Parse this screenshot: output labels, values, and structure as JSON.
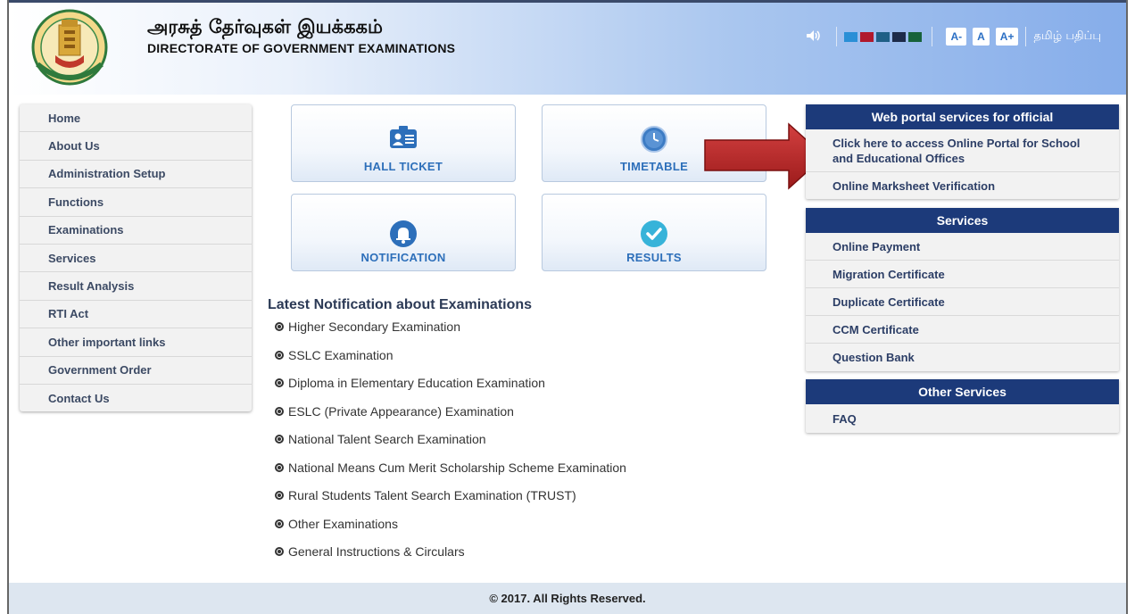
{
  "header": {
    "title_tamil": "அரசுத் தேர்வுகள் இயக்ககம்",
    "title_english": "DIRECTORATE OF GOVERNMENT EXAMINATIONS",
    "emblem_icon": "tamilnadu-emblem-icon",
    "speaker_icon": "speaker-icon",
    "color_themes": [
      "#2a8fd6",
      "#b0182c",
      "#1f5f86",
      "#1d2b4a",
      "#17623a"
    ],
    "font_buttons": [
      "A-",
      "A",
      "A+"
    ],
    "language_link": "தமிழ் பதிப்பு"
  },
  "nav": {
    "items": [
      "Home",
      "About Us",
      "Administration Setup",
      "Functions",
      "Examinations",
      "Services",
      "Result Analysis",
      "RTI Act",
      "Other important links",
      "Government Order",
      "Contact Us"
    ]
  },
  "tiles": {
    "hall_ticket": "HALL TICKET",
    "timetable": "TIMETABLE",
    "notification": "NOTIFICATION",
    "results": "RESULTS"
  },
  "notifications": {
    "title": "Latest Notification about Examinations",
    "items": [
      "Higher Secondary Examination",
      "SSLC Examination",
      "Diploma in Elementary Education Examination",
      "ESLC (Private Appearance) Examination",
      "National Talent Search Examination",
      "National Means Cum Merit Scholarship Scheme Examination",
      "Rural Students Talent Search Examination (TRUST)",
      "Other Examinations",
      "General Instructions & Circulars"
    ]
  },
  "portal": {
    "title": "Web portal services for official",
    "link1": "Click here to access Online Portal for School and Educational Offices",
    "link2": "Online Marksheet Verification"
  },
  "services": {
    "title": "Services",
    "items": [
      "Online Payment",
      "Migration Certificate",
      "Duplicate Certificate",
      "CCM Certificate",
      "Question Bank"
    ]
  },
  "other_services": {
    "title": "Other Services",
    "items": [
      "FAQ"
    ]
  },
  "footer": {
    "copyright": "© 2017. All Rights Reserved."
  }
}
